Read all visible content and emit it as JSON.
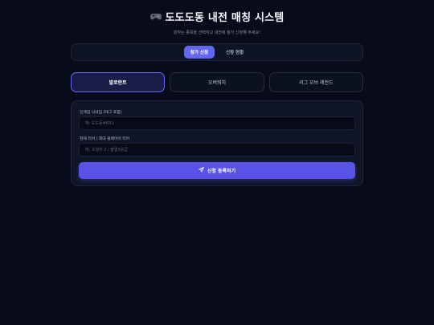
{
  "header": {
    "icon": "gamepad-icon",
    "title": "도도도동 내전 매칭 시스템",
    "subtitle": "원하는 종목을 선택하고 내전에 참가 신청해 주세요!"
  },
  "tabs": [
    {
      "label": "참가 신청",
      "active": true
    },
    {
      "label": "신청 현황",
      "active": false
    }
  ],
  "games": [
    {
      "label": "발로란트",
      "selected": true
    },
    {
      "label": "오버워치",
      "selected": false
    },
    {
      "label": "리그 오브 레전드",
      "selected": false
    }
  ],
  "form": {
    "nickname_label": "인게임 닉네임 (태그 포함)",
    "nickname_placeholder": "예: 도도동#KR1",
    "nickname_value": "",
    "tier_label": "현재 티어 / 최대 플레이어 티어",
    "tier_placeholder": "예: 초월자 2 / 불멸3등급",
    "tier_value": "",
    "submit_label": "신청 등록하기",
    "submit_icon": "send-icon"
  },
  "colors": {
    "background": "#070b1a",
    "accent": "#6366f1",
    "button": "#5852e6",
    "selected_card": "#1a1d48"
  }
}
